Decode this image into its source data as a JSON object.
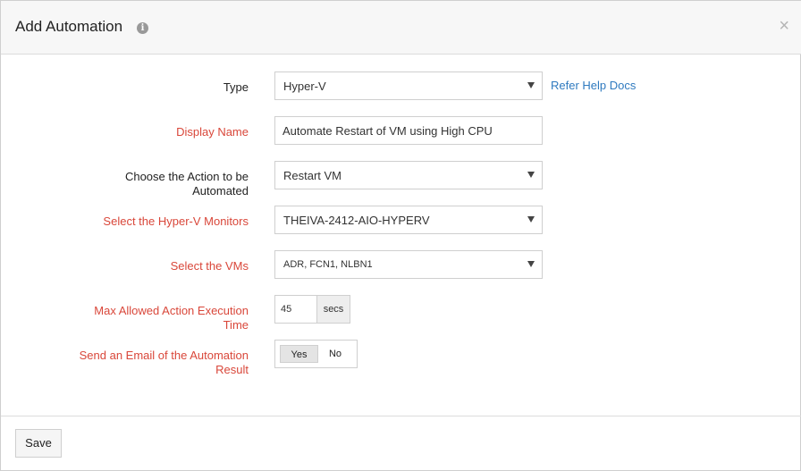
{
  "dialog": {
    "title": "Add Automation",
    "info_icon": "i",
    "close_icon": "×"
  },
  "form": {
    "type": {
      "label": "Type",
      "value": "Hyper-V",
      "help_link": "Refer Help Docs"
    },
    "display_name": {
      "label": "Display Name",
      "value": "Automate Restart of VM using High CPU"
    },
    "action": {
      "label": "Choose the Action to be Automated",
      "value": "Restart VM"
    },
    "monitors": {
      "label": "Select the Hyper-V Monitors",
      "value": "THEIVA-2412-AIO-HYPERV"
    },
    "vms": {
      "label": "Select the VMs",
      "value": "ADR, FCN1, NLBN1"
    },
    "max_time": {
      "label": "Max Allowed Action Execution Time",
      "value": "45",
      "unit": "secs"
    },
    "email": {
      "label": "Send an Email of the Automation Result",
      "yes": "Yes",
      "no": "No",
      "selected": "Yes"
    }
  },
  "footer": {
    "save_label": "Save"
  },
  "colors": {
    "required_label": "#d9473a",
    "link": "#2f7abf",
    "header_bg": "#f7f7f7"
  },
  "icons": {
    "info": "info-icon",
    "close": "close-icon",
    "dropdown": "caret-down-icon"
  }
}
